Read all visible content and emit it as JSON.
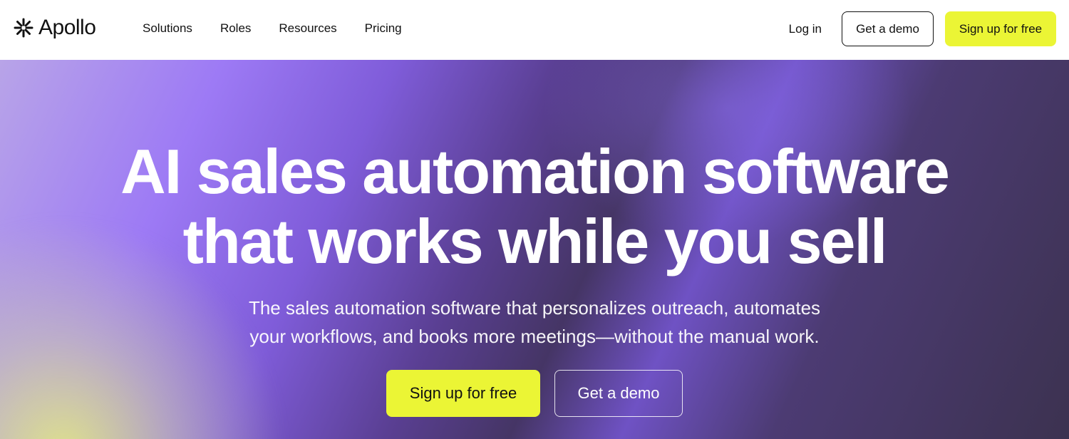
{
  "brand": {
    "name": "Apollo",
    "logo_icon": "asterisk-burst-icon"
  },
  "nav": {
    "links": [
      "Solutions",
      "Roles",
      "Resources",
      "Pricing"
    ],
    "login_label": "Log in",
    "demo_label": "Get a demo",
    "signup_label": "Sign up for free"
  },
  "hero": {
    "headline_line1": "AI sales automation software",
    "headline_line2": "that works while you sell",
    "subhead_line1": "The sales automation software that personalizes outreach, automates",
    "subhead_line2": "your workflows, and books more meetings—without the manual work.",
    "signup_label": "Sign up for free",
    "demo_label": "Get a demo"
  },
  "colors": {
    "accent": "#ebf535",
    "hero_purple": "#7f5cd9",
    "hero_dark": "#3c3250"
  }
}
